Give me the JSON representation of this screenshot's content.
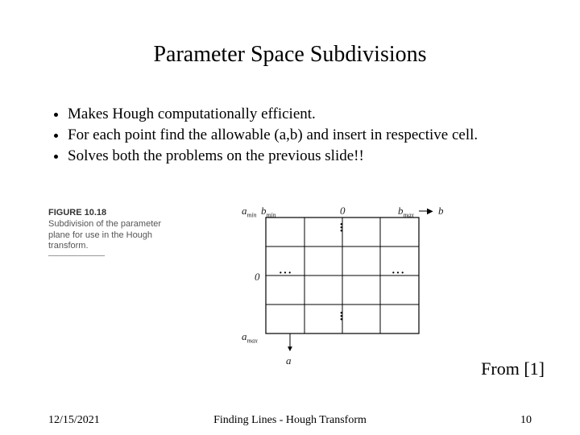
{
  "title": "Parameter Space Subdivisions",
  "bullets": [
    "Makes Hough computationally efficient.",
    "For each point find the allowable (a,b) and insert in respective cell.",
    "Solves both the problems on the previous slide!!"
  ],
  "figure": {
    "number": "FIGURE 10.18",
    "caption": "Subdivision of the parameter plane for use in the Hough transform.",
    "labels": {
      "amin": "a",
      "amin_sub": "min",
      "amax": "a",
      "amax_sub": "max",
      "bmin": "b",
      "bmin_sub": "min",
      "bmax": "b",
      "bmax_sub": "max",
      "zero_top": "0",
      "zero_left": "0",
      "axis_b": "b",
      "axis_a": "a"
    }
  },
  "from_ref": "From [1]",
  "footer": {
    "date": "12/15/2021",
    "title": "Finding Lines - Hough Transform",
    "page": "10"
  }
}
